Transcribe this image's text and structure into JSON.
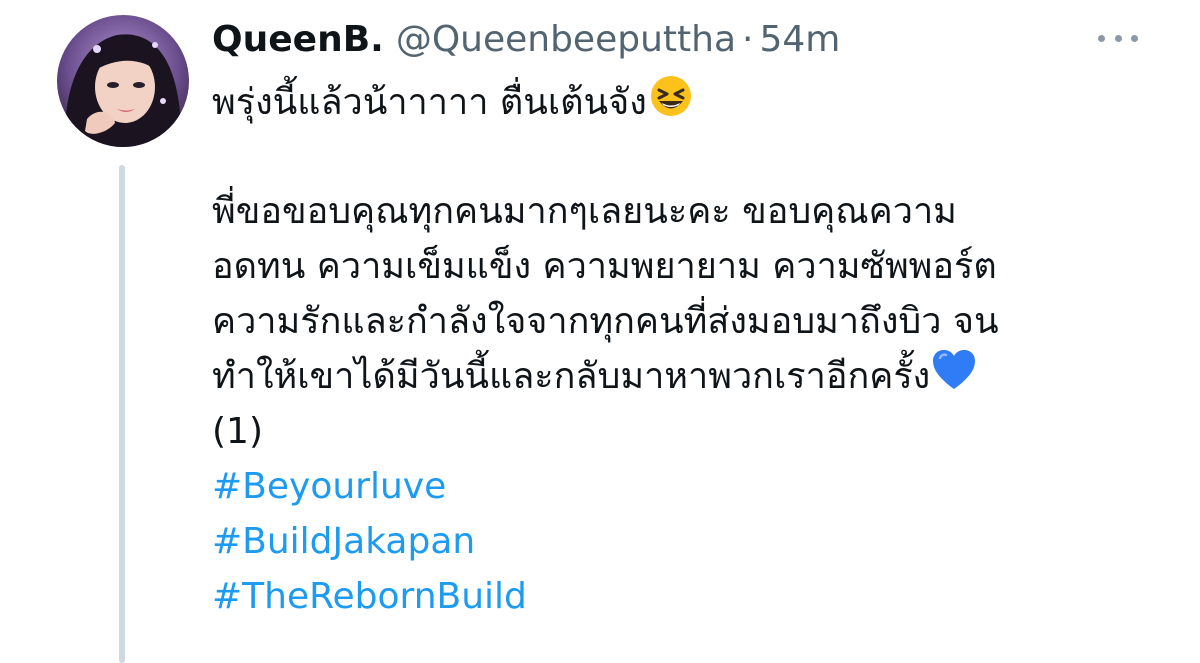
{
  "tweet": {
    "display_name": "QueenB.",
    "handle": "@Queenbeeputtha",
    "separator": "·",
    "timestamp": "54m",
    "more_icon": "more-horizontal-icon",
    "avatar_icon": "user-avatar",
    "first_line": "พรุ่งนี้แล้วน้าาาาา ตื่นเต้นจัง",
    "first_line_emoji": "grinning-squinting-face-emoji",
    "body_lines": [
      "พี่ขอขอบคุณทุกคนมากๆเลยนะคะ ขอบคุณความ",
      "อดทน ความเข็มแข็ง ความพยายาม ความซัพพอร์ต",
      "ความรักและกำลังใจจากทุกคนที่ส่งมอบมาถึงบิว จน",
      "ทำให้เขาได้มีวันนี้และกลับมาหาพวกเราอีกครั้ง"
    ],
    "last_body_emoji": "blue-heart-emoji",
    "counter_line": "(1)",
    "hashtags": [
      "#Beyourluve",
      "#BuildJakapan",
      "#TheRebornBuild"
    ]
  },
  "colors": {
    "text": "#0f1419",
    "secondary": "#536471",
    "link": "#1d9bf0",
    "thread_line": "#cfd9de",
    "heart": "#2f7cf6",
    "emoji_face": "#fcc21b"
  }
}
